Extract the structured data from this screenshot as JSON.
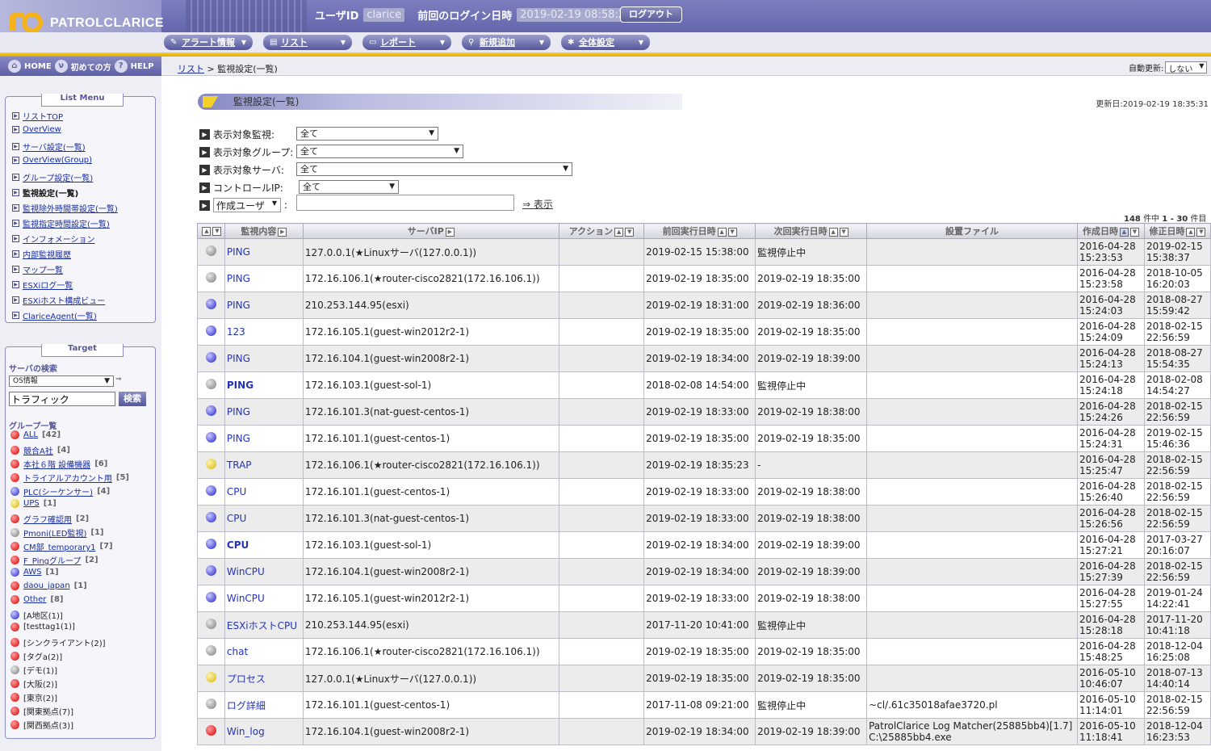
{
  "header": {
    "logo": "PATROLCLARICE",
    "user_label": "ユーザID",
    "user_id": "clarice",
    "last_login_label": "前回のログイン日時",
    "last_login": "2019-02-19 08:58:23",
    "logout": "ログアウト"
  },
  "menu": [
    {
      "label": "アラート情報",
      "icon": "alert-icon"
    },
    {
      "label": "リスト",
      "icon": "list-icon"
    },
    {
      "label": "レポート",
      "icon": "report-icon"
    },
    {
      "label": "新規追加",
      "icon": "add-user-icon"
    },
    {
      "label": "全体設定",
      "icon": "settings-icon"
    }
  ],
  "nav": {
    "home": "HOME",
    "first": "初めての方",
    "help": "HELP"
  },
  "breadcrumb": {
    "parent": "リスト",
    "sep": " > ",
    "current": "監視設定(一覧)"
  },
  "auto_refresh": {
    "label": "自動更新:",
    "value": "しない"
  },
  "list_menu": {
    "title": "List Menu",
    "items": [
      "リストTOP",
      "OverView",
      "サーバ設定(一覧)",
      "OverView(Group)",
      "グループ設定(一覧)",
      "監視設定(一覧)",
      "監視除外時間帯設定(一覧)",
      "監視指定時間設定(一覧)",
      "インフォメーション",
      "内部監視履歴",
      "マップ一覧",
      "ESXiログ一覧",
      "ESXiホスト構成ビュー",
      "ClariceAgent(一覧)"
    ]
  },
  "target": {
    "title": "Target",
    "search_label": "サーバの検索",
    "search_type": "OS情報",
    "search_value": "トラフィック",
    "search_button": "検索",
    "group_label": "グループ一覧",
    "groups": [
      {
        "name": "ALL",
        "count": "[42]",
        "color": "red",
        "link": true
      },
      {
        "name": "競合A社",
        "count": "[4]",
        "color": "red",
        "link": true
      },
      {
        "name": "本社６階 設備機器",
        "count": "[6]",
        "color": "red",
        "link": true
      },
      {
        "name": "トライアルアカウント用",
        "count": "[5]",
        "color": "red",
        "link": true
      },
      {
        "name": "PLC(シーケンサー)",
        "count": "[4]",
        "color": "blue",
        "link": true
      },
      {
        "name": "UPS",
        "count": "[1]",
        "color": "yellow",
        "link": true
      },
      {
        "name": "グラフ確認用",
        "count": "[2]",
        "color": "red",
        "link": true
      },
      {
        "name": "Pmoni(LED監視)",
        "count": "[1]",
        "color": "gray",
        "link": true
      },
      {
        "name": "CM部_temporary1",
        "count": "[7]",
        "color": "red",
        "link": true
      },
      {
        "name": "F_Pingグループ",
        "count": "[2]",
        "color": "red",
        "link": true
      },
      {
        "name": "AWS",
        "count": "[1]",
        "color": "blue",
        "link": true
      },
      {
        "name": "daou_japan",
        "count": "[1]",
        "color": "red",
        "link": true
      },
      {
        "name": "Other",
        "count": "[8]",
        "color": "red",
        "link": true
      },
      {
        "name": "[A地区(1)]",
        "count": "",
        "color": "blue",
        "link": false
      },
      {
        "name": "[testtag1(1)]",
        "count": "",
        "color": "red",
        "link": false
      },
      {
        "name": "[シンクライアント(2)]",
        "count": "",
        "color": "red",
        "link": false
      },
      {
        "name": "[タグa(2)]",
        "count": "",
        "color": "red",
        "link": false
      },
      {
        "name": "[デモ(1)]",
        "count": "",
        "color": "gray",
        "link": false
      },
      {
        "name": "[大阪(2)]",
        "count": "",
        "color": "red",
        "link": false
      },
      {
        "name": "[東京(2)]",
        "count": "",
        "color": "red",
        "link": false
      },
      {
        "name": "[関東拠点(7)]",
        "count": "",
        "color": "red",
        "link": false
      },
      {
        "name": "[関西拠点(3)]",
        "count": "",
        "color": "red",
        "link": false
      }
    ]
  },
  "page": {
    "title": "監視設定(一覧)",
    "updated": "更新日:2019-02-19 18:35:31"
  },
  "filters": {
    "monitor_label": "表示対象監視:",
    "monitor_value": "全て",
    "group_label": "表示対象グループ:",
    "group_value": "全て",
    "server_label": "表示対象サーバ:",
    "server_value": "全て",
    "ip_label": "コントロールIP:",
    "ip_value": "全て",
    "user_select": "作成ユーザ",
    "user_colon": ":",
    "show": "⇒ 表示"
  },
  "count": {
    "total": "148",
    "unit1": "件中",
    "range": "1 - 30",
    "unit2": "件目"
  },
  "columns": [
    "監視内容",
    "サーバIP",
    "アクション",
    "前回実行日時",
    "次回実行日時",
    "設置ファイル",
    "作成日時",
    "修正日時"
  ],
  "rows": [
    {
      "status": "gray",
      "monitor": "PING",
      "bold": false,
      "ip": "127.0.0.1(★Linuxサーバ(127.0.0.1))",
      "last": "2019-02-15 15:38:00",
      "next": "監視停止中",
      "file1": "",
      "file2": "",
      "c1": "2016-04-28",
      "c2": "15:23:53",
      "m1": "2019-02-15",
      "m2": "15:38:37"
    },
    {
      "status": "gray",
      "monitor": "PING",
      "bold": false,
      "ip": "172.16.106.1(★router-cisco2821(172.16.106.1))",
      "last": "2019-02-19 18:35:00",
      "next": "2019-02-19 18:35:00",
      "file1": "",
      "file2": "",
      "c1": "2016-04-28",
      "c2": "15:23:58",
      "m1": "2018-10-05",
      "m2": "16:20:03"
    },
    {
      "status": "blue",
      "monitor": "PING",
      "bold": false,
      "ip": "210.253.144.95(esxi)",
      "last": "2019-02-19 18:31:00",
      "next": "2019-02-19 18:36:00",
      "file1": "",
      "file2": "",
      "c1": "2016-04-28",
      "c2": "15:24:03",
      "m1": "2018-08-27",
      "m2": "15:59:42"
    },
    {
      "status": "blue",
      "monitor": "123",
      "bold": false,
      "ip": "172.16.105.1(guest-win2012r2-1)",
      "last": "2019-02-19 18:35:00",
      "next": "2019-02-19 18:35:00",
      "file1": "",
      "file2": "",
      "c1": "2016-04-28",
      "c2": "15:24:09",
      "m1": "2018-02-15",
      "m2": "22:56:59"
    },
    {
      "status": "blue",
      "monitor": "PING",
      "bold": false,
      "ip": "172.16.104.1(guest-win2008r2-1)",
      "last": "2019-02-19 18:34:00",
      "next": "2019-02-19 18:39:00",
      "file1": "",
      "file2": "",
      "c1": "2016-04-28",
      "c2": "15:24:13",
      "m1": "2018-08-27",
      "m2": "15:54:35"
    },
    {
      "status": "gray",
      "monitor": "PING",
      "bold": true,
      "ip": "172.16.103.1(guest-sol-1)",
      "last": "2018-02-08 14:54:00",
      "next": "監視停止中",
      "file1": "",
      "file2": "",
      "c1": "2016-04-28",
      "c2": "15:24:18",
      "m1": "2018-02-08",
      "m2": "14:54:27"
    },
    {
      "status": "blue",
      "monitor": "PING",
      "bold": false,
      "ip": "172.16.101.3(nat-guest-centos-1)",
      "last": "2019-02-19 18:33:00",
      "next": "2019-02-19 18:38:00",
      "file1": "",
      "file2": "",
      "c1": "2016-04-28",
      "c2": "15:24:26",
      "m1": "2018-02-15",
      "m2": "22:56:59"
    },
    {
      "status": "blue",
      "monitor": "PING",
      "bold": false,
      "ip": "172.16.101.1(guest-centos-1)",
      "last": "2019-02-19 18:35:00",
      "next": "2019-02-19 18:35:00",
      "file1": "",
      "file2": "",
      "c1": "2016-04-28",
      "c2": "15:24:31",
      "m1": "2019-02-15",
      "m2": "15:46:36"
    },
    {
      "status": "yellow",
      "monitor": "TRAP",
      "bold": false,
      "ip": "172.16.106.1(★router-cisco2821(172.16.106.1))",
      "last": "2019-02-19 18:35:23",
      "next": "-",
      "file1": "",
      "file2": "",
      "c1": "2016-04-28",
      "c2": "15:25:47",
      "m1": "2018-02-15",
      "m2": "22:56:59"
    },
    {
      "status": "blue",
      "monitor": "CPU",
      "bold": false,
      "ip": "172.16.101.1(guest-centos-1)",
      "last": "2019-02-19 18:33:00",
      "next": "2019-02-19 18:38:00",
      "file1": "",
      "file2": "",
      "c1": "2016-04-28",
      "c2": "15:26:40",
      "m1": "2018-02-15",
      "m2": "22:56:59"
    },
    {
      "status": "blue",
      "monitor": "CPU",
      "bold": false,
      "ip": "172.16.101.3(nat-guest-centos-1)",
      "last": "2019-02-19 18:33:00",
      "next": "2019-02-19 18:38:00",
      "file1": "",
      "file2": "",
      "c1": "2016-04-28",
      "c2": "15:26:56",
      "m1": "2018-02-15",
      "m2": "22:56:59"
    },
    {
      "status": "blue",
      "monitor": "CPU",
      "bold": true,
      "ip": "172.16.103.1(guest-sol-1)",
      "last": "2019-02-19 18:34:00",
      "next": "2019-02-19 18:39:00",
      "file1": "",
      "file2": "",
      "c1": "2016-04-28",
      "c2": "15:27:21",
      "m1": "2017-03-27",
      "m2": "20:16:07"
    },
    {
      "status": "blue",
      "monitor": "WinCPU",
      "bold": false,
      "ip": "172.16.104.1(guest-win2008r2-1)",
      "last": "2019-02-19 18:34:00",
      "next": "2019-02-19 18:39:00",
      "file1": "",
      "file2": "",
      "c1": "2016-04-28",
      "c2": "15:27:39",
      "m1": "2018-02-15",
      "m2": "22:56:59"
    },
    {
      "status": "blue",
      "monitor": "WinCPU",
      "bold": false,
      "ip": "172.16.105.1(guest-win2012r2-1)",
      "last": "2019-02-19 18:33:00",
      "next": "2019-02-19 18:38:00",
      "file1": "",
      "file2": "",
      "c1": "2016-04-28",
      "c2": "15:27:55",
      "m1": "2019-01-24",
      "m2": "14:22:41"
    },
    {
      "status": "gray",
      "monitor": "ESXiホストCPU",
      "bold": false,
      "ip": "210.253.144.95(esxi)",
      "last": "2017-11-20 10:41:00",
      "next": "監視停止中",
      "file1": "",
      "file2": "",
      "c1": "2016-04-28",
      "c2": "15:28:18",
      "m1": "2017-11-20",
      "m2": "10:41:18"
    },
    {
      "status": "gray",
      "monitor": "chat",
      "bold": false,
      "ip": "172.16.106.1(★router-cisco2821(172.16.106.1))",
      "last": "2019-02-19 18:35:00",
      "next": "2019-02-19 18:35:00",
      "file1": "",
      "file2": "",
      "c1": "2016-04-28",
      "c2": "15:48:25",
      "m1": "2018-12-04",
      "m2": "16:25:08"
    },
    {
      "status": "yellow",
      "monitor": "プロセス",
      "bold": false,
      "ip": "127.0.0.1(★Linuxサーバ(127.0.0.1))",
      "last": "2019-02-19 18:35:00",
      "next": "2019-02-19 18:35:00",
      "file1": "",
      "file2": "",
      "c1": "2016-05-10",
      "c2": "10:46:07",
      "m1": "2018-07-13",
      "m2": "14:40:14"
    },
    {
      "status": "gray",
      "monitor": "ログ詳細",
      "bold": false,
      "ip": "172.16.101.1(guest-centos-1)",
      "last": "2017-11-08 09:21:00",
      "next": "監視停止中",
      "file1": "~cl/.61c35018afae3720.pl",
      "file2": "",
      "c1": "2016-05-10",
      "c2": "11:14:01",
      "m1": "2018-02-15",
      "m2": "22:56:59"
    },
    {
      "status": "red",
      "monitor": "Win_log",
      "bold": false,
      "ip": "172.16.104.1(guest-win2008r2-1)",
      "last": "2019-02-19 18:34:00",
      "next": "2019-02-19 18:39:00",
      "file1": "PatrolClarice Log Matcher(25885bb4)[1.7]",
      "file2": "C:\\25885bb4.exe",
      "c1": "2016-05-10",
      "c2": "11:18:41",
      "m1": "2018-12-04",
      "m2": "16:23:53"
    }
  ]
}
